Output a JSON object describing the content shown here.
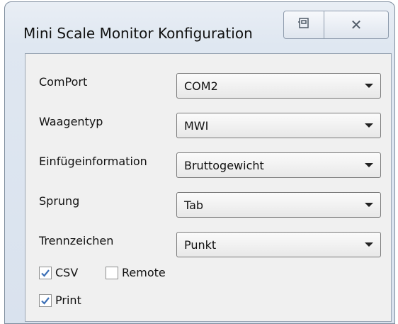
{
  "window": {
    "title": "Mini Scale Monitor Konfiguration",
    "restore_icon": "restore-icon",
    "close_glyph": "✕",
    "close_icon": "close-icon"
  },
  "fields": [
    {
      "label": "ComPort",
      "value": "COM2"
    },
    {
      "label": "Waagentyp",
      "value": "MWI"
    },
    {
      "label": "Einfügeinformation",
      "value": "Bruttogewicht"
    },
    {
      "label": "Sprung",
      "value": "Tab"
    },
    {
      "label": "Trennzeichen",
      "value": "Punkt"
    }
  ],
  "options": {
    "csv": {
      "label": "CSV",
      "checked": true
    },
    "remote": {
      "label": "Remote",
      "checked": false
    },
    "print": {
      "label": "Print",
      "checked": true
    }
  },
  "colors": {
    "check_mark": "#3b6fb6"
  }
}
